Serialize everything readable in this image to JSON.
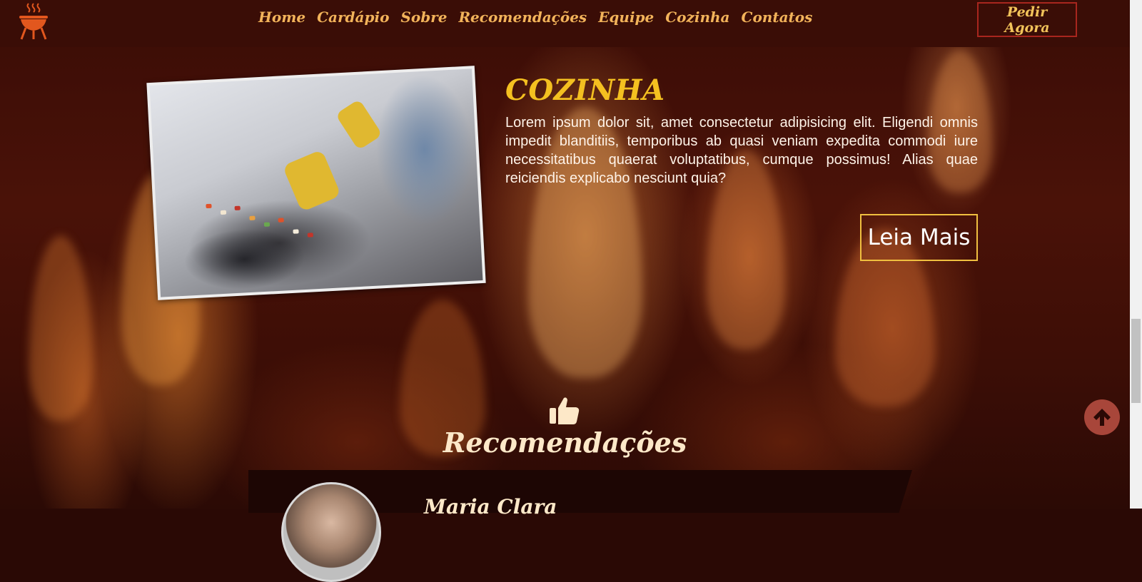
{
  "header": {
    "nav": [
      "Home",
      "Cardápio",
      "Sobre",
      "Recomendações",
      "Equipe",
      "Cozinha",
      "Contatos"
    ],
    "order_label": "Pedir Agora"
  },
  "kitchen": {
    "title": "COZINHA",
    "text": "Lorem ipsum dolor sit, amet consectetur adipisicing elit. Eligendi omnis impedit blanditiis, temporibus ab quasi veniam expedita commodi iure necessitatibus quaerat voluptatibus, cumque possimus! Alias quae reiciendis explicabo nesciunt quia?",
    "read_more_label": "Leia Mais"
  },
  "recommendations": {
    "title": "Recomendações",
    "first_name": "Maria Clara"
  },
  "icons": {
    "logo": "grill-icon",
    "thumbs": "thumbs-up-icon",
    "scroll_top": "arrow-up-icon"
  },
  "colors": {
    "nav_text": "#f2b35a",
    "accent_gold": "#f4c020",
    "order_border": "#a8261e",
    "scroll_button": "#a8463a"
  }
}
